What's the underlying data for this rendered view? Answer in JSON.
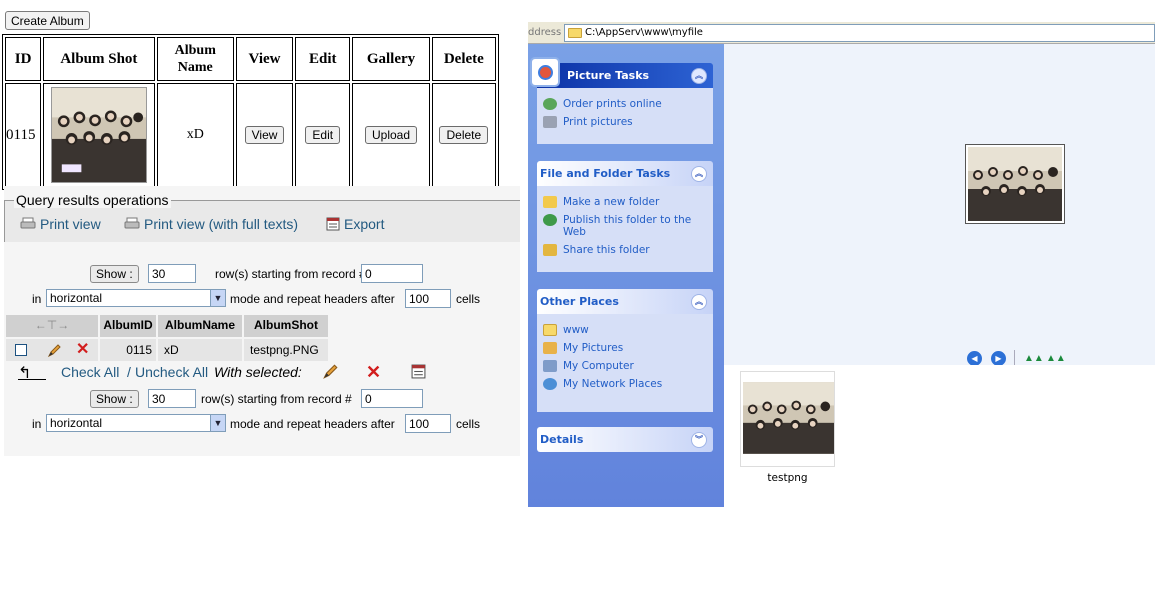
{
  "left": {
    "create_album_label": "Create Album",
    "table": {
      "headers": [
        "ID",
        "Album Shot",
        "Album Name",
        "View",
        "Edit",
        "Gallery",
        "Delete"
      ],
      "row": {
        "id": "0115",
        "album_name": "xD",
        "view_label": "View",
        "edit_label": "Edit",
        "upload_label": "Upload",
        "delete_label": "Delete"
      }
    }
  },
  "pma": {
    "legend": "Query results operations",
    "print_view": "Print view",
    "print_view_full": "Print view (with full texts)",
    "export": "Export",
    "show_label": "Show :",
    "rows_value": "30",
    "rows_text": "row(s) starting from record #",
    "start_value": "0",
    "in_label": "in",
    "mode_value": "horizontal",
    "mode_text": "mode and repeat headers after",
    "repeat_value": "100",
    "cells_text": "cells",
    "columns": [
      "AlbumID",
      "AlbumName",
      "AlbumShot"
    ],
    "row": {
      "album_id": "0115",
      "album_name": "xD",
      "album_shot": "testpng.PNG"
    },
    "check_all": "Check All",
    "slash": "/",
    "uncheck_all": "Uncheck All",
    "with_selected": "With selected:"
  },
  "explorer": {
    "address_label": "ddress",
    "address_path": "C:\\AppServ\\www\\myfile",
    "picture_tasks": {
      "title": "Picture Tasks",
      "items": [
        "Order prints online",
        "Print pictures"
      ]
    },
    "file_tasks": {
      "title": "File and Folder Tasks",
      "items": [
        "Make a new folder",
        "Publish this folder to the Web",
        "Share this folder"
      ]
    },
    "other_places": {
      "title": "Other Places",
      "items": [
        "www",
        "My Pictures",
        "My Computer",
        "My Network Places"
      ]
    },
    "details_title": "Details",
    "file_name": "testpng"
  }
}
